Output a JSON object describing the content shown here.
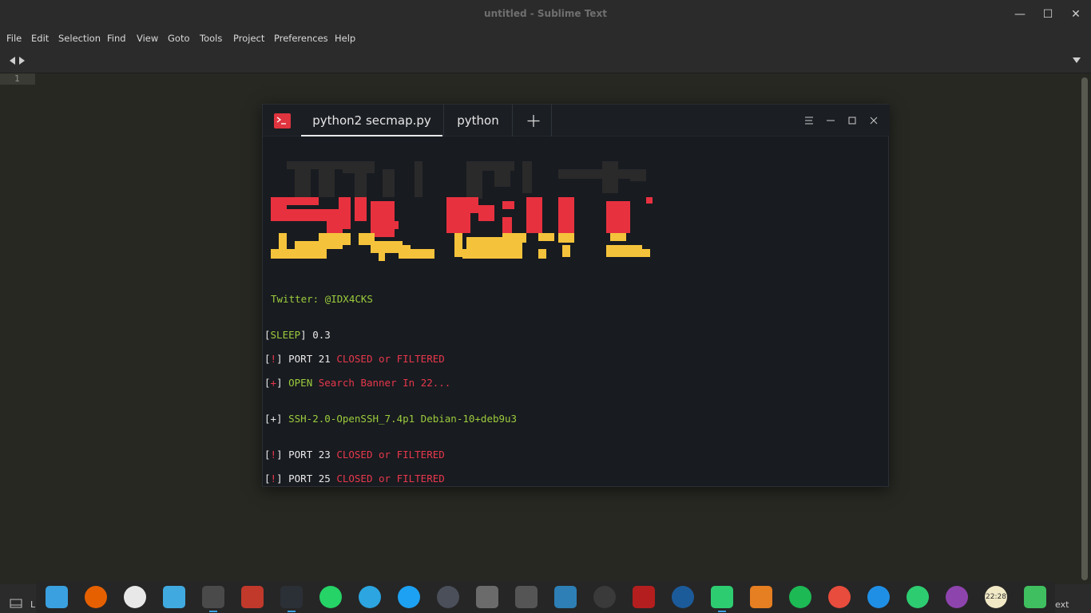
{
  "window": {
    "title": "untitled - Sublime Text",
    "minimize": "—",
    "maximize": "☐",
    "close": "✕"
  },
  "menu": [
    "File",
    "Edit",
    "Selection",
    "Find",
    "View",
    "Goto",
    "Tools",
    "Project",
    "Preferences",
    "Help"
  ],
  "editor": {
    "line_number": "1"
  },
  "terminal": {
    "tabs": [
      "python2 secmap.py",
      "python"
    ],
    "banner_colors": [
      "#2a2a2a",
      "#e8313f",
      "#f5c33b"
    ],
    "lines": {
      "twitter": "Twitter: @IDX4CKS",
      "sleep_bracket_open": "[",
      "sleep_label": "SLEEP",
      "sleep_rest": "] 0.3",
      "l1_open": "[",
      "l1_sym": "!",
      "l1_close": "] PORT 21 ",
      "l1_status": "CLOSED or FILTERED",
      "l2_open": "[",
      "l2_sym": "+",
      "l2_close": "] ",
      "l2_open_word": "OPEN",
      "l2_rest": " Search Banner In 22...",
      "l3_prefix": "[+] ",
      "l3_banner": "SSH-2.0-OpenSSH_7.4p1 Debian-10+deb9u3",
      "l4_open": "[",
      "l4_sym": "!",
      "l4_close": "] PORT 23 ",
      "l4_status": "CLOSED or FILTERED",
      "l5_open": "[",
      "l5_sym": "!",
      "l5_close": "] PORT 25 ",
      "l5_status": "CLOSED or FILTERED"
    }
  },
  "statusbar": {
    "left_text": "L",
    "right_text": "ext"
  },
  "dock": {
    "apps": [
      "launcher-icon",
      "firefox-icon",
      "chrome-icon",
      "files-icon",
      "sublime-icon",
      "editor-icon",
      "terminal-icon",
      "whatsapp-icon",
      "telegram-icon",
      "twitter-icon",
      "ghost-icon",
      "camera-icon",
      "vm-icon",
      "monitor-icon",
      "gimp-icon",
      "filezilla-icon",
      "video-icon",
      "music-icon",
      "store-icon",
      "spotify-icon",
      "eject-icon",
      "wifi-icon",
      "updates-icon",
      "power-icon",
      "clock-icon",
      "trash-icon"
    ],
    "clock_text": "22:28"
  }
}
